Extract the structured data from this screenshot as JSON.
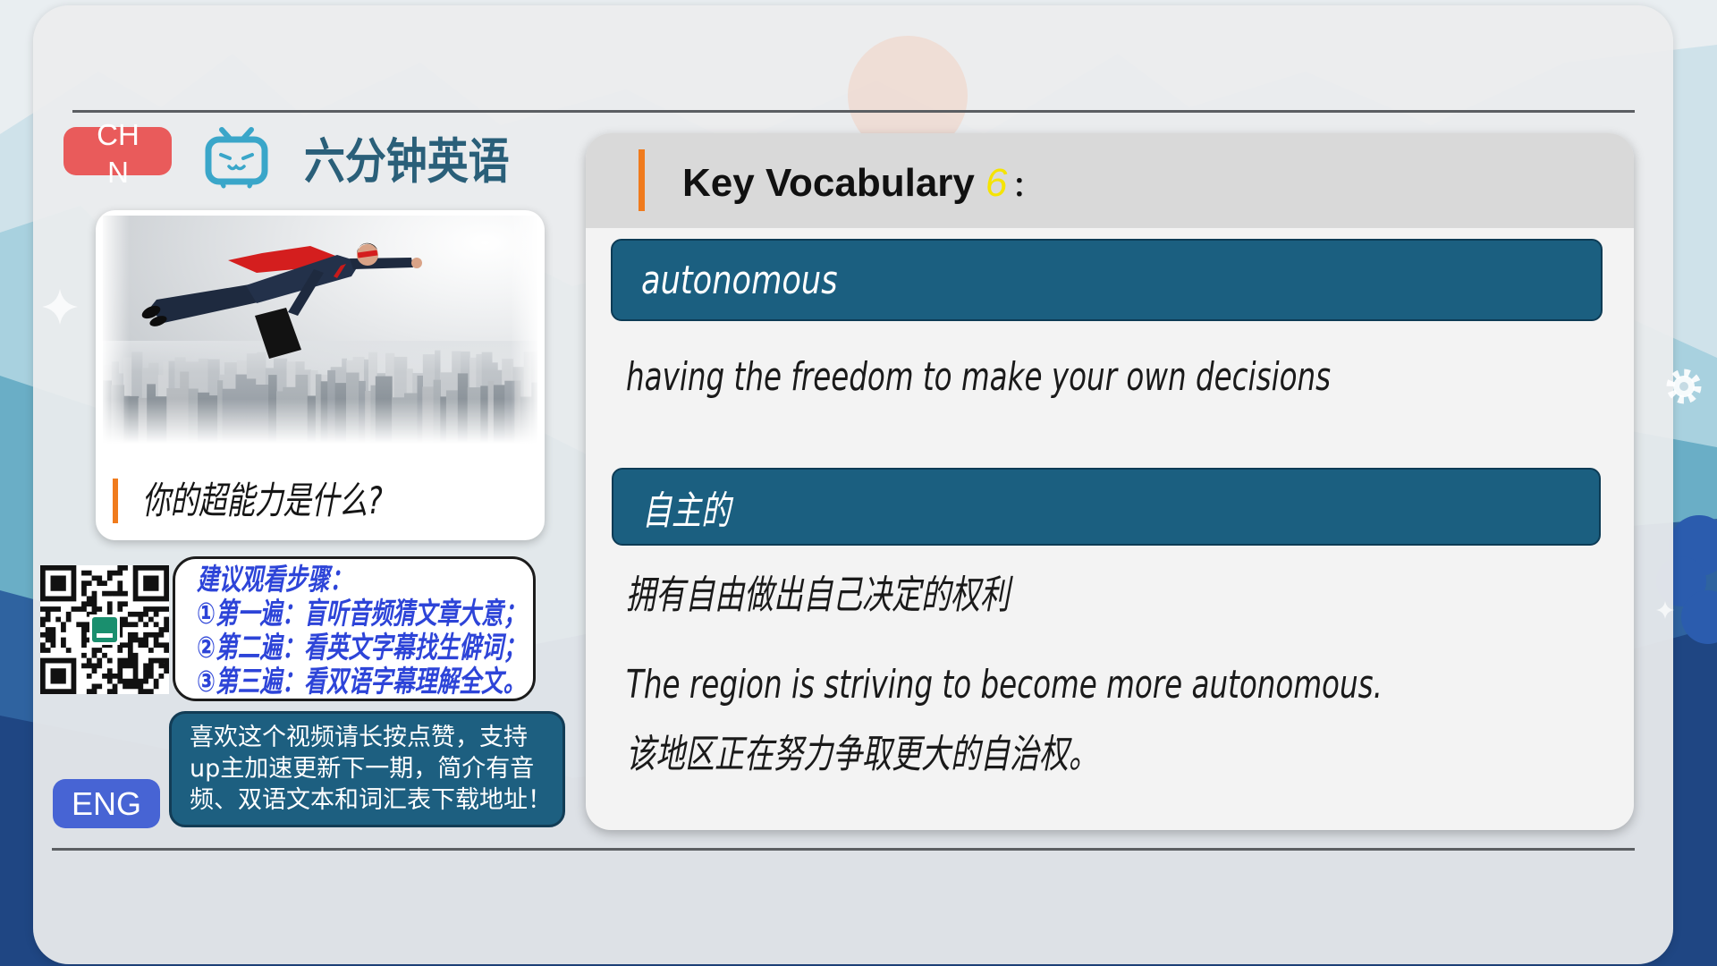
{
  "app": {
    "title": "六分钟英语"
  },
  "lang_buttons": {
    "chn": "CHN",
    "eng": "ENG"
  },
  "lesson": {
    "question": "你的超能力是什么?"
  },
  "steps": {
    "title": "建议观看步骤：",
    "items": [
      "①第一遍：盲听音频猜文章大意；",
      "②第二遍：看英文字幕找生僻词；",
      "③第三遍：看双语字幕理解全文。"
    ]
  },
  "support": {
    "lines": [
      "喜欢这个视频请长按点赞，支持",
      "up主加速更新下一期，简介有音",
      "频、双语文本和词汇表下载地址！"
    ]
  },
  "vocab": {
    "heading": "Key Vocabulary",
    "number": "6",
    "colon": "：",
    "word": "autonomous",
    "definition": "having the freedom to make your own decisions",
    "word_cn": "自主的",
    "definition_cn": "拥有自由做出自己决定的权利",
    "example": "The region is striving to become more autonomous.",
    "example_cn": "该地区正在努力争取更大的自治权。"
  },
  "icons": {
    "logo": "bilibili-tv-icon",
    "settings": "gear-icon",
    "decoration": "sparkle-icon",
    "qr": "qr-code-icon"
  },
  "colors": {
    "accent_orange": "#f07b1d",
    "word_bar": "#1b5f80",
    "chn_button": "#e95b5b",
    "eng_button": "#4764d4",
    "steps_text": "#2d44d8",
    "vocab_number": "#f5e400",
    "title_text": "#2a5f79"
  }
}
